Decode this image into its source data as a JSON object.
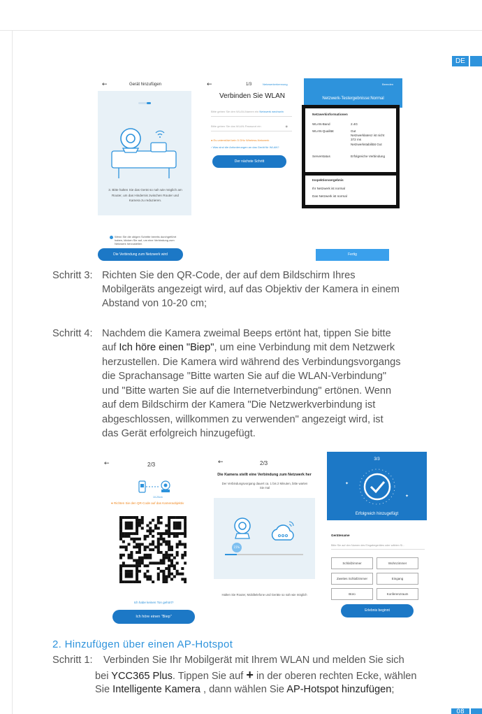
{
  "lang_tab": "DE",
  "page_number": "08",
  "colors": {
    "accent": "#2e93dc",
    "button": "#1c78c6",
    "panel": "#e8f1f7"
  },
  "s1": {
    "title": "Gerät hinzufügen",
    "instruction": "3. Bitte halten Sie das Gerät so nah wie möglich am Router, um das Hindernis zwischen Router und Kamera zu reduzieren.",
    "checkbox_text": "Wenn Sie die obigen Schritte bereits durchgeführt haben, klicken Sie auf, um eine Verbindung zum Netzwerk herzustellen",
    "button": "Die Verbindung zum Netzwerk wird"
  },
  "s2": {
    "step": "1/3",
    "link": "Netzwerkerkennung",
    "title": "Verbinden Sie WLAN",
    "ssid_placeholder": "Bitte geben Sie den WLAN-Namen ein",
    "switch_link": "Netzwerk wechseln",
    "pw_placeholder": "Bitte geben Sie das WLAN-Passwort ein",
    "warning": "Es unterstützt kein 5 GHz Wireless-Netzwerk",
    "link2": "Was sind die Anforderungen an das Gerät für WLAN?",
    "button": "Der nächste Schritt"
  },
  "s3": {
    "top_right": "Beenden",
    "title": "Netzwerk-Testergebnisse:Normal",
    "info_title": "Netzwerkinformationen",
    "rows": [
      {
        "k": "WLAN-Band",
        "v": "2.4G"
      },
      {
        "k": "WLAN-Qualität",
        "v": "Gut\nNetzwerklatenz ist nicht 372 ms\nNetzwerkstabilität Gut"
      },
      {
        "k": "Serverstatus",
        "v": "Erfolgreiche Verbindung"
      }
    ],
    "result_title": "Inspektionsergebnis",
    "result_lines": [
      "Ihr Netzwerk ist normal",
      "Das Netzwerk ist normal"
    ],
    "button": "Fertig"
  },
  "step3": {
    "label": "Schritt 3:",
    "lines": [
      "Richten Sie den QR-Code, der auf dem Bildschirm Ihres",
      "Mobilgeräts angezeigt wird, auf das Objektiv der Kamera in einem",
      "Abstand von 10-20 cm;"
    ]
  },
  "step4": {
    "label": "Schritt 4:",
    "line1": "Nachdem die Kamera zweimal Beeps ertönt hat, tippen Sie bitte",
    "line2_pre": "auf ",
    "line2_bold": "Ich höre einen \"Biep\"",
    "line2_post": ", um eine Verbindung mit dem Netzwerk",
    "lines_rest": [
      "herzustellen. Die Kamera wird während des Verbindungsvorgangs",
      "die Sprachansage \"Bitte warten Sie auf die WLAN-Verbindung\"",
      "und \"Bitte warten Sie auf die Internetverbindung\" ertönen. Wenn",
      "auf dem Bildschirm der Kamera \"Die Netzwerkverbindung ist",
      "abgeschlossen, willkommen zu verwenden\" angezeigt wird, ist",
      "das Gerät erfolgreich hinzugefügt."
    ]
  },
  "s4": {
    "step": "2/3",
    "distance": "10-20cm",
    "instruction": "Richten Sie den QR-Code auf das Kameraobjektiv",
    "link": "Ich habe keinen Ton gehört?",
    "button": "Ich höre einen \"Biep\""
  },
  "s5": {
    "step": "2/3",
    "title": "Die Kamera stellt eine Verbindung zum Netzwerk her",
    "subtitle": "Der Verbindungsvorgang dauert ca. 1 bis 2 Minuten, bitte warten Sie mal",
    "progress_value": 0.15,
    "progress_label": "15%",
    "footer": "Halten Sie Router, Mobiltelefone und Geräte so nah wie möglich"
  },
  "s6": {
    "step": "3/3",
    "success": "Erfolgreich hinzugefügt",
    "name_label": "Gerätename",
    "name_placeholder": "Bitte Sie auf den Namen des Eingabegerätes oder wählen Si...",
    "rooms": [
      "Schlafzimmer",
      "Wohnzimmer",
      "Zweites Schlafzimmer",
      "Eingang",
      "Büro",
      "Konferenzraum"
    ],
    "button": "Erlebnis beginnt"
  },
  "section2": {
    "heading": "2. Hinzufügen über einen AP-Hotspot",
    "label": "Schritt 1:",
    "line1": "Verbinden Sie Ihr Mobilgerät mit Ihrem WLAN und melden Sie sich",
    "l2_a": "bei ",
    "l2_b": "YCC365 Plus",
    "l2_c": ". Tippen Sie auf ",
    "l2_plus": "+",
    "l2_d": " in der oberen rechten Ecke, wählen",
    "l3_a": "Sie ",
    "l3_b": "Intelligente Kamera",
    "l3_c": " , dann wählen Sie ",
    "l3_d": "AP-Hotspot hinzufügen",
    "l3_e": ";"
  }
}
